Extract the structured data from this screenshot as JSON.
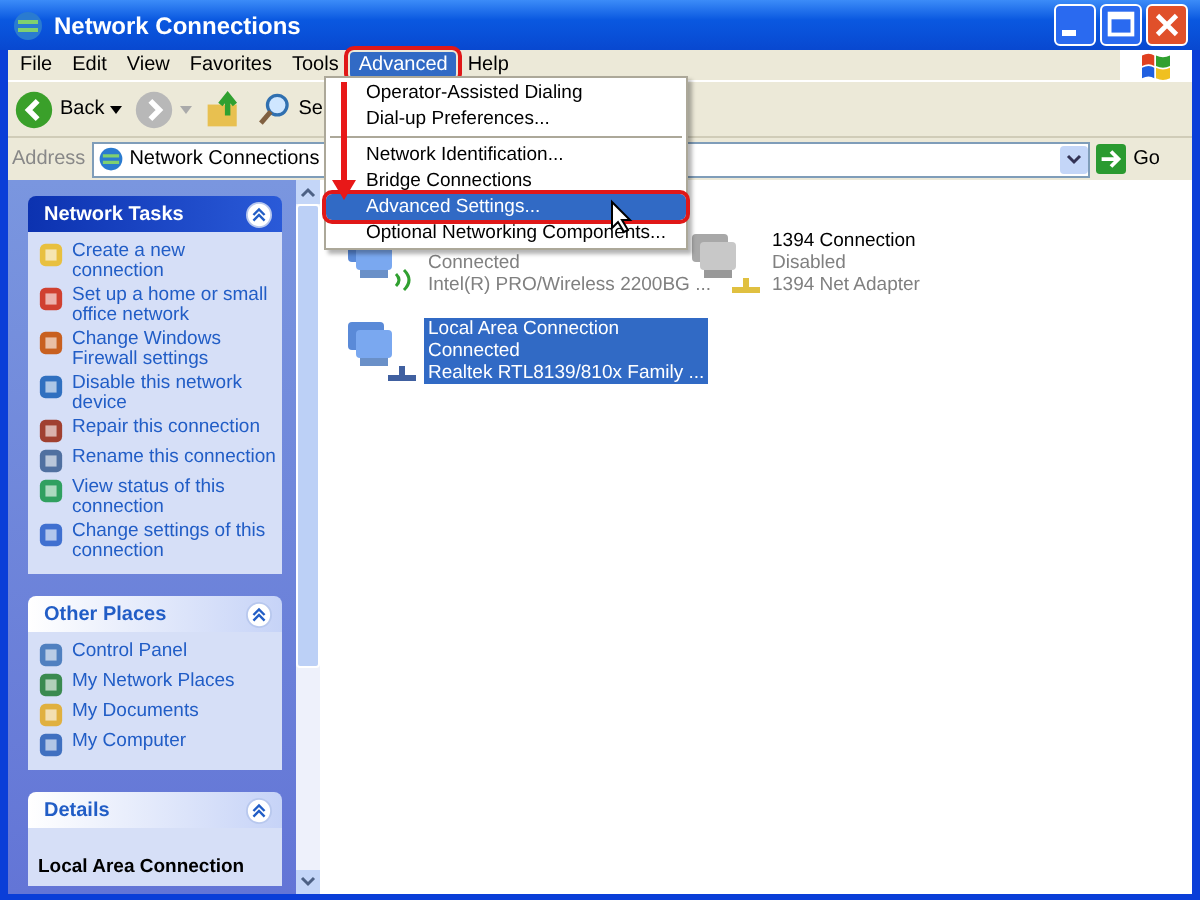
{
  "window": {
    "title": "Network Connections"
  },
  "menu": [
    {
      "label": "File",
      "selected": false,
      "annotated": false
    },
    {
      "label": "Edit",
      "selected": false,
      "annotated": false
    },
    {
      "label": "View",
      "selected": false,
      "annotated": false
    },
    {
      "label": "Favorites",
      "selected": false,
      "annotated": false
    },
    {
      "label": "Tools",
      "selected": false,
      "annotated": false
    },
    {
      "label": "Advanced",
      "selected": true,
      "annotated": true
    },
    {
      "label": "Help",
      "selected": false,
      "annotated": false
    }
  ],
  "toolbar": [
    {
      "kind": "back",
      "label": "Back"
    },
    {
      "kind": "forward"
    },
    {
      "kind": "up"
    },
    {
      "kind": "search",
      "label": "Se"
    }
  ],
  "address": {
    "label": "Address",
    "value": "Network Connections",
    "go": "Go"
  },
  "dropdown": [
    {
      "kind": "item",
      "label": "Operator-Assisted Dialing",
      "selected": false,
      "annotated": false
    },
    {
      "kind": "item",
      "label": "Dial-up Preferences...",
      "selected": false,
      "annotated": false
    },
    {
      "kind": "separator"
    },
    {
      "kind": "item",
      "label": "Network Identification...",
      "selected": false,
      "annotated": false
    },
    {
      "kind": "item",
      "label": "Bridge Connections",
      "selected": false,
      "annotated": false
    },
    {
      "kind": "item",
      "label": "Advanced Settings...",
      "selected": true,
      "annotated": true
    },
    {
      "kind": "item",
      "label": "Optional Networking Components...",
      "selected": false,
      "annotated": false
    }
  ],
  "sidebar": [
    {
      "title": "Network Tasks",
      "dark": true,
      "items": [
        "Create a new connection",
        "Set up a home or small office network",
        "Change Windows Firewall settings",
        "Disable this network device",
        "Repair this connection",
        "Rename this connection",
        "View status of this connection",
        "Change settings of this connection"
      ]
    },
    {
      "title": "Other Places",
      "dark": false,
      "items": [
        "Control Panel",
        "My Network Places",
        "My Documents",
        "My Computer"
      ]
    },
    {
      "title": "Details",
      "dark": false,
      "heading": "Local Area Connection"
    }
  ],
  "connections": [
    {
      "kind": "wireless",
      "status": "Connected",
      "device": "Intel(R) PRO/Wireless 2200BG ...",
      "selected": false
    },
    {
      "kind": "firewire",
      "name": "1394 Connection",
      "status": "Disabled",
      "device": "1394 Net Adapter",
      "selected": false
    },
    {
      "kind": "lan",
      "name": "Local Area Connection",
      "status": "Connected",
      "device": "Realtek RTL8139/810x Family ...",
      "selected": true
    }
  ]
}
